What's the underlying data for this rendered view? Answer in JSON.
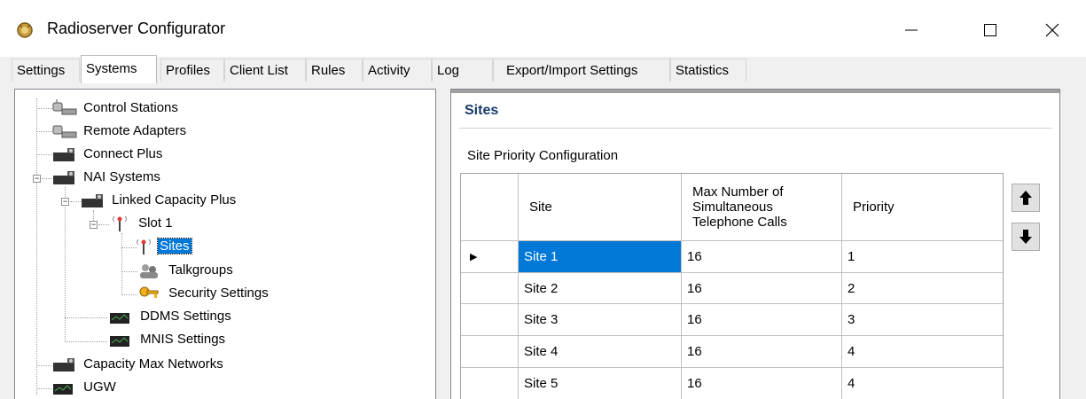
{
  "window": {
    "title": "Radioserver Configurator",
    "minimize_glyph": "—",
    "maximize_glyph": "☐",
    "close_glyph": "✕"
  },
  "tabs": [
    {
      "label": "Settings"
    },
    {
      "label": "Systems",
      "active": true
    },
    {
      "label": "Profiles"
    },
    {
      "label": "Client List"
    },
    {
      "label": "Rules"
    },
    {
      "label": "Activity"
    },
    {
      "label": "Log"
    },
    {
      "label": "Export/Import Settings"
    },
    {
      "label": "Statistics"
    }
  ],
  "tree": {
    "items": [
      {
        "label": "Control Stations",
        "icon": "control-station-icon"
      },
      {
        "label": "Remote Adapters",
        "icon": "remote-adapter-icon"
      },
      {
        "label": "Connect Plus",
        "icon": "network-device-icon"
      },
      {
        "label": "NAI Systems",
        "icon": "network-device-icon"
      },
      {
        "label": "Linked Capacity Plus",
        "icon": "network-device-icon"
      },
      {
        "label": "Slot 1",
        "icon": "antenna-icon"
      },
      {
        "label": "Sites",
        "icon": "antenna-icon",
        "selected": true
      },
      {
        "label": "Talkgroups",
        "icon": "talkgroup-icon"
      },
      {
        "label": "Security Settings",
        "icon": "key-icon"
      },
      {
        "label": "DDMS Settings",
        "icon": "monitor-icon"
      },
      {
        "label": "MNIS Settings",
        "icon": "monitor-icon"
      },
      {
        "label": "Capacity Max Networks",
        "icon": "network-device-icon"
      },
      {
        "label": "UGW",
        "icon": "monitor-icon"
      }
    ]
  },
  "panel": {
    "title": "Sites",
    "section_label": "Site Priority Configuration"
  },
  "grid": {
    "columns": [
      "Site",
      "Max Number of Simultaneous Telephone Calls",
      "Priority"
    ],
    "header_lines": [
      "Max Number of",
      "Simultaneous",
      "Telephone Calls"
    ],
    "current_row_marker": "▶",
    "rows": [
      [
        "Site 1",
        "16",
        "1"
      ],
      [
        "Site 2",
        "16",
        "2"
      ],
      [
        "Site 3",
        "16",
        "3"
      ],
      [
        "Site 4",
        "16",
        "4"
      ],
      [
        "Site 5",
        "16",
        "4"
      ]
    ]
  },
  "buttons": {
    "move_up_icon": "arrow-up-icon",
    "move_down_icon": "arrow-down-icon"
  },
  "colors": {
    "selection": "#0078d7",
    "section_title": "#1a3a6b",
    "window_border": "#1e88e5"
  }
}
